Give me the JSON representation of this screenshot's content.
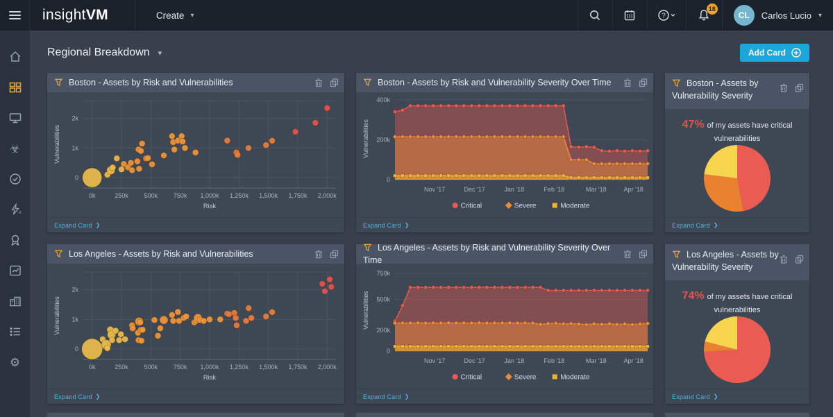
{
  "topbar": {
    "logo_light": "insight",
    "logo_bold": "VM",
    "create_label": "Create",
    "notification_count": "18",
    "user_initials": "CL",
    "user_name": "Carlos Lucio",
    "help_glyph": "?"
  },
  "sidebar": {
    "items": [
      "home",
      "dashboards",
      "assets",
      "vulnerabilities",
      "policies",
      "automation",
      "goals",
      "reports",
      "administration",
      "activity-log",
      "settings"
    ],
    "active": "dashboards"
  },
  "page": {
    "title": "Regional Breakdown",
    "add_card_label": "Add Card",
    "expand_card_label": "Expand Card"
  },
  "colors": {
    "accent_blue": "#1ba7dc",
    "link_blue": "#4fb6e2",
    "funnel_orange": "#e0a33e",
    "critical_red": "#e2544d",
    "severe_orange": "#ee8b38",
    "moderate_yellow": "#eeb331",
    "bubble_yellow": "#e8d061",
    "grid_line": "#4b5561",
    "axis_text": "#a9b3bf"
  },
  "cards": [
    {
      "title": "Boston - Assets by Risk and Vulnerabilities",
      "type": "scatter",
      "chart": {
        "xlabel": "Risk",
        "ylabel": "Vulnerabilities",
        "xticks": [
          0,
          250,
          500,
          750,
          1000,
          1250,
          1500,
          1750,
          2000
        ],
        "xtick_labels": [
          "0k",
          "250k",
          "500k",
          "750k",
          "1,000k",
          "1,250k",
          "1,500k",
          "1,750k",
          "2,000k"
        ],
        "yticks": [
          0,
          1000,
          2000
        ],
        "ytick_labels": [
          "0",
          "1k",
          "2k"
        ],
        "xdomain": [
          -75,
          2075
        ],
        "ydomain": [
          -350,
          2600
        ],
        "color_bands": [
          [
            260,
            "#edbd4b"
          ],
          [
            1100,
            "#f0973a"
          ],
          [
            1650,
            "#e87e3d"
          ],
          [
            99999,
            "#e2544d"
          ]
        ],
        "points": [
          [
            0,
            0,
            14
          ],
          [
            130,
            100
          ],
          [
            160,
            250,
            6
          ],
          [
            175,
            340
          ],
          [
            210,
            650
          ],
          [
            250,
            280
          ],
          [
            270,
            460
          ],
          [
            305,
            350
          ],
          [
            330,
            500
          ],
          [
            340,
            250
          ],
          [
            385,
            550
          ],
          [
            395,
            950
          ],
          [
            400,
            300
          ],
          [
            415,
            900
          ],
          [
            425,
            1150
          ],
          [
            460,
            650
          ],
          [
            475,
            660
          ],
          [
            510,
            450
          ],
          [
            610,
            750
          ],
          [
            680,
            1400
          ],
          [
            690,
            1200
          ],
          [
            700,
            950
          ],
          [
            730,
            1250
          ],
          [
            762,
            1400
          ],
          [
            770,
            1220
          ],
          [
            790,
            1000
          ],
          [
            880,
            850
          ],
          [
            1150,
            1250
          ],
          [
            1228,
            850
          ],
          [
            1238,
            768
          ],
          [
            1330,
            1000
          ],
          [
            1480,
            1100
          ],
          [
            1532,
            1245
          ],
          [
            1730,
            1550
          ],
          [
            1900,
            1850
          ],
          [
            2000,
            2350
          ]
        ]
      }
    },
    {
      "title": "Boston - Assets by Risk and Vulnerability Severity Over Time",
      "type": "time",
      "chart": {
        "ylabel": "Vulnerabilities",
        "yticks": [
          0,
          200,
          400
        ],
        "ytick_labels": [
          "0",
          "200k",
          "400k"
        ],
        "ymax": 410,
        "months": [
          "Nov '17",
          "Dec '17",
          "Jan '18",
          "Feb '18",
          "Mar '18",
          "Apr '18"
        ],
        "month_fracs": [
          0.157,
          0.315,
          0.472,
          0.63,
          0.796,
          0.944
        ],
        "series": [
          {
            "name": "Critical",
            "shape": "circle",
            "color": "#e65a4f",
            "values": [
              340,
              348,
              370,
              370,
              370,
              370,
              370,
              370,
              370,
              370,
              370,
              370,
              370,
              370,
              370,
              370,
              370,
              370,
              370,
              370,
              370,
              370,
              370,
              165,
              163,
              165,
              162,
              145,
              143,
              145,
              143,
              145,
              143,
              145
            ]
          },
          {
            "name": "Severe",
            "shape": "diamond",
            "color": "#ee8b38",
            "values": [
              215,
              215,
              215,
              215,
              215,
              215,
              215,
              215,
              215,
              215,
              215,
              215,
              215,
              215,
              215,
              215,
              215,
              215,
              215,
              215,
              215,
              215,
              215,
              100,
              100,
              100,
              80,
              80,
              80,
              80,
              80,
              80,
              80,
              80
            ]
          },
          {
            "name": "Moderate",
            "shape": "square",
            "color": "#eeb331",
            "values": [
              20,
              20,
              20,
              20,
              20,
              20,
              20,
              20,
              20,
              20,
              20,
              20,
              20,
              20,
              20,
              20,
              20,
              20,
              20,
              20,
              20,
              20,
              20,
              10,
              10,
              10,
              10,
              10,
              10,
              10,
              10,
              10,
              10,
              10
            ]
          }
        ]
      }
    },
    {
      "title": "Boston - Assets by Vulnerability Severity",
      "type": "pie",
      "stat_value": "47%",
      "stat_text": "of my assets have critical vulnerabilities",
      "chart": {
        "slices": [
          {
            "label": "Critical",
            "value": 47,
            "color": "#ea5b52"
          },
          {
            "label": "Severe",
            "value": 30,
            "color": "#e9812f"
          },
          {
            "label": "Moderate",
            "value": 23,
            "color": "#f7d54e"
          }
        ]
      }
    },
    {
      "title": "Los Angeles - Assets by Risk and Vulnerabilities",
      "type": "scatter",
      "chart": {
        "xlabel": "Risk",
        "ylabel": "Vulnerabilities",
        "xticks": [
          0,
          250,
          500,
          750,
          1000,
          1250,
          1500,
          1750,
          2000
        ],
        "xtick_labels": [
          "0k",
          "250k",
          "500k",
          "750k",
          "1,000k",
          "1,250k",
          "1,500k",
          "1,750k",
          "2,000k"
        ],
        "yticks": [
          0,
          1000,
          2000
        ],
        "ytick_labels": [
          "0",
          "1k",
          "2k"
        ],
        "xdomain": [
          -75,
          2075
        ],
        "ydomain": [
          -350,
          2600
        ],
        "color_bands": [
          [
            300,
            "#edbd4b"
          ],
          [
            1100,
            "#f0973a"
          ],
          [
            1900,
            "#e87e3d"
          ],
          [
            99999,
            "#e2544d"
          ]
        ],
        "points": [
          [
            0,
            0,
            15
          ],
          [
            90,
            330
          ],
          [
            120,
            150,
            7
          ],
          [
            130,
            30
          ],
          [
            155,
            650,
            5
          ],
          [
            165,
            480,
            6
          ],
          [
            170,
            300
          ],
          [
            200,
            620
          ],
          [
            230,
            300
          ],
          [
            245,
            500
          ],
          [
            280,
            330
          ],
          [
            340,
            800
          ],
          [
            345,
            700
          ],
          [
            390,
            550
          ],
          [
            395,
            300
          ],
          [
            400,
            930,
            6
          ],
          [
            410,
            900
          ],
          [
            415,
            650
          ],
          [
            420,
            280
          ],
          [
            430,
            650
          ],
          [
            530,
            980
          ],
          [
            560,
            450
          ],
          [
            580,
            700
          ],
          [
            610,
            980,
            6
          ],
          [
            680,
            1150
          ],
          [
            690,
            950
          ],
          [
            730,
            1250
          ],
          [
            740,
            950
          ],
          [
            780,
            1050
          ],
          [
            800,
            1100
          ],
          [
            870,
            900
          ],
          [
            885,
            955
          ],
          [
            900,
            1050,
            6
          ],
          [
            920,
            980
          ],
          [
            950,
            950
          ],
          [
            1000,
            1000
          ],
          [
            1090,
            1000
          ],
          [
            1150,
            1200
          ],
          [
            1165,
            1175
          ],
          [
            1210,
            1220
          ],
          [
            1222,
            1050
          ],
          [
            1230,
            800
          ],
          [
            1310,
            950
          ],
          [
            1332,
            1380
          ],
          [
            1355,
            1050
          ],
          [
            1480,
            1100
          ],
          [
            1532,
            1245
          ],
          [
            1958,
            2200
          ],
          [
            1980,
            1950
          ],
          [
            2022,
            2350
          ],
          [
            2035,
            2100
          ]
        ]
      }
    },
    {
      "title": "Los Angeles - Assets by Risk and Vulnerability Severity Over Time",
      "type": "time",
      "chart": {
        "ylabel": "Vulnerabilities",
        "yticks": [
          0,
          200,
          500,
          750
        ],
        "ytick_labels": [
          "0",
          "200k",
          "500k",
          "750k"
        ],
        "ymax": 790,
        "months": [
          "Nov '17",
          "Dec '17",
          "Jan '18",
          "Feb '18",
          "Mar '18",
          "Apr '18"
        ],
        "month_fracs": [
          0.157,
          0.315,
          0.472,
          0.63,
          0.796,
          0.944
        ],
        "series": [
          {
            "name": "Critical",
            "shape": "circle",
            "color": "#e65a4f",
            "values": [
              290,
              440,
              615,
              615,
              615,
              615,
              615,
              615,
              615,
              615,
              615,
              615,
              615,
              615,
              615,
              615,
              615,
              615,
              615,
              615,
              585,
              585,
              585,
              585,
              585,
              585,
              585,
              585,
              585,
              585,
              585,
              585,
              585,
              585
            ]
          },
          {
            "name": "Severe",
            "shape": "diamond",
            "color": "#ee8b38",
            "values": [
              270,
              271,
              270,
              272,
              270,
              271,
              270,
              272,
              270,
              271,
              270,
              272,
              270,
              271,
              270,
              272,
              270,
              271,
              270,
              256,
              265,
              268,
              262,
              265,
              260,
              255,
              262,
              258,
              263,
              256,
              261,
              255,
              261,
              266
            ]
          },
          {
            "name": "Moderate",
            "shape": "square",
            "color": "#eeb331",
            "values": [
              45,
              45,
              45,
              45,
              45,
              45,
              45,
              45,
              45,
              45,
              45,
              45,
              45,
              45,
              45,
              45,
              45,
              45,
              45,
              45,
              45,
              45,
              45,
              45,
              45,
              45,
              45,
              45,
              45,
              45,
              45,
              45,
              45,
              45
            ]
          }
        ]
      }
    },
    {
      "title": "Los Angeles - Assets by Vulnerability Severity",
      "type": "pie",
      "stat_value": "74%",
      "stat_text": "of my assets have critical vulnerabilities",
      "chart": {
        "slices": [
          {
            "label": "Critical",
            "value": 74,
            "color": "#ea5b52"
          },
          {
            "label": "Severe",
            "value": 5,
            "color": "#e9812f"
          },
          {
            "label": "Moderate",
            "value": 21,
            "color": "#f7d54e"
          }
        ]
      }
    }
  ]
}
